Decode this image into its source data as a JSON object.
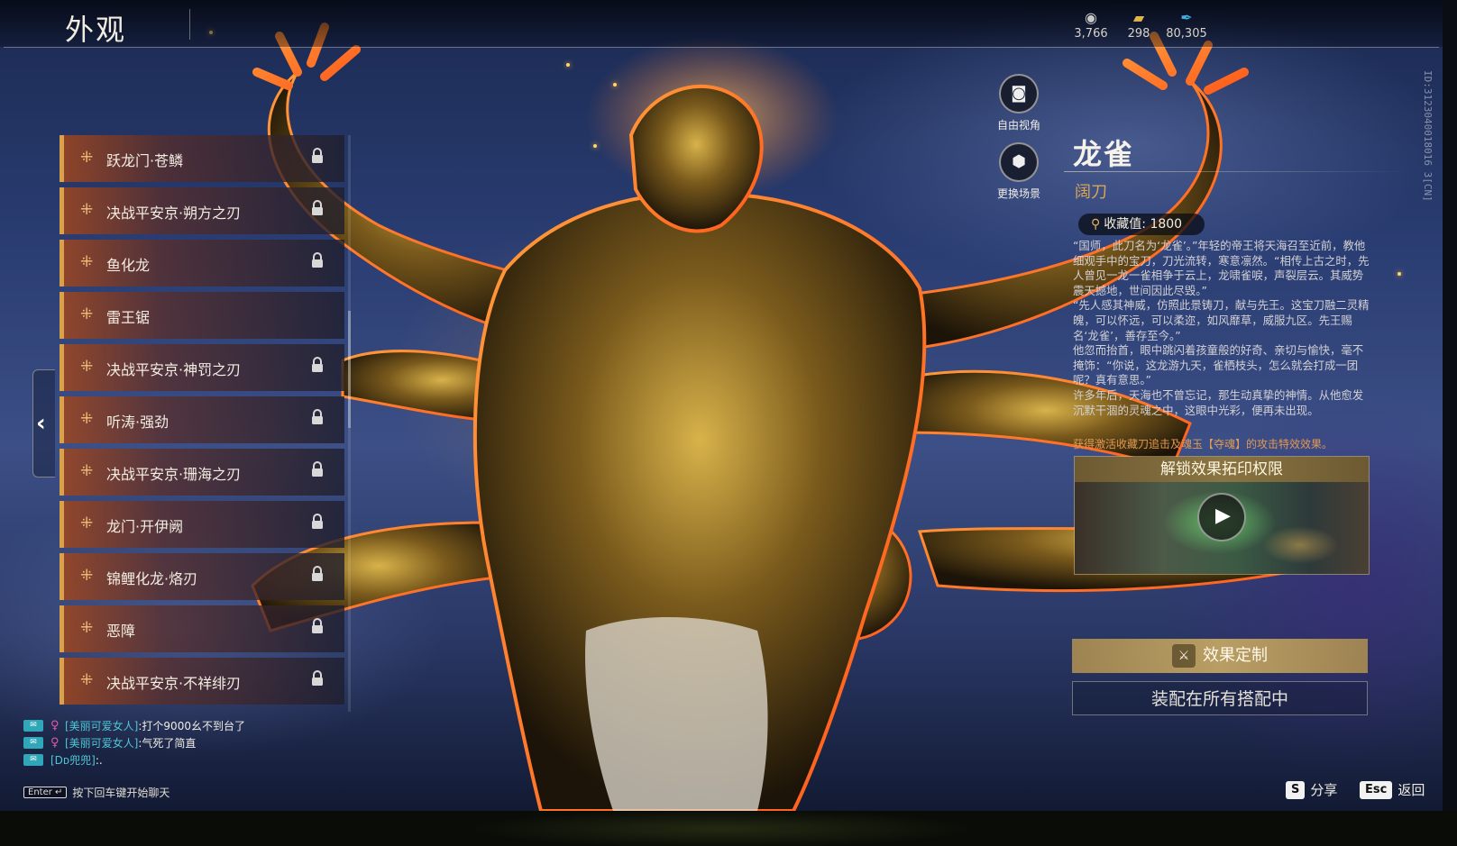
{
  "header": {
    "title": "外观",
    "currencies": [
      {
        "icon": "coin-stack-icon",
        "glyph": "◉",
        "color": "#c9c9c9",
        "value": "3,766"
      },
      {
        "icon": "ticket-icon",
        "glyph": "▰",
        "color": "#e2b54a",
        "value": "298"
      },
      {
        "icon": "feather-icon",
        "glyph": "✒",
        "color": "#3fb0e0",
        "value": "80,305"
      }
    ]
  },
  "skin_list": {
    "items": [
      {
        "label": "跃龙门·苍鳞",
        "locked": true
      },
      {
        "label": "决战平安京·朔方之刃",
        "locked": true
      },
      {
        "label": "鱼化龙",
        "locked": true
      },
      {
        "label": "雷王锯",
        "locked": false
      },
      {
        "label": "决战平安京·神罚之刃",
        "locked": true
      },
      {
        "label": "听涛·强劲",
        "locked": true
      },
      {
        "label": "决战平安京·珊海之刃",
        "locked": true
      },
      {
        "label": "龙门·开伊阙",
        "locked": true
      },
      {
        "label": "锦鲤化龙·烙刃",
        "locked": true
      },
      {
        "label": "恶障",
        "locked": true
      },
      {
        "label": "决战平安京·不祥绯刃",
        "locked": true
      }
    ]
  },
  "camera": {
    "free_view": "自由视角",
    "change_scene": "更换场景"
  },
  "detail": {
    "name": "龙雀",
    "weapon_type": "阔刀",
    "collect_label": "收藏值:",
    "collect_value": "1800",
    "lore": [
      "“国师，此刀名为‘龙雀’。”年轻的帝王将天海召至近前，教他细观手中的宝刀，刀光流转，寒意凛然。“相传上古之时，先人曾见一龙一雀相争于云上，龙啸雀唳，声裂层云。其威势震天撼地，世间因此尽毁。”",
      "“先人感其神威，仿照此景铸刀，献与先王。这宝刀融二灵精魄，可以怀远，可以柔迩，如风靡草，威服九区。先王赐名‘龙雀’，善存至今。”",
      "他忽而抬首，眼中跳闪着孩童般的好奇、亲切与愉快，毫不掩饰：“你说，这龙游九天，雀栖枝头，怎么就会打成一团呢？真有意思。”",
      "许多年后，天海也不曾忘记，那生动真挚的神情。从他愈发沉默干涸的灵魂之中，这眼中光彩，便再未出现。"
    ],
    "effect_note": "获得激活收藏刀追击及魂玉【夺魂】的攻击特效效果。",
    "unlock_title": "解锁效果拓印权限",
    "customize_label": "效果定制",
    "equip_label": "装配在所有搭配中"
  },
  "side_id": "ID:3123040018016 3[CN]",
  "chat": {
    "messages": [
      {
        "name": "[美丽可爱女人]",
        "sex": "♀",
        "text": ":打个9000幺不到台了"
      },
      {
        "name": "[美丽可爱女人]",
        "sex": "♀",
        "text": ":气死了简直"
      },
      {
        "name": "[Dᴅ兜兜]",
        "sex": "",
        "text": ":."
      }
    ],
    "enter_key": "Enter ↵",
    "hint": "按下回车键开始聊天"
  },
  "hotkeys": {
    "share_key": "S",
    "share_label": "分享",
    "back_key": "Esc",
    "back_label": "返回"
  }
}
